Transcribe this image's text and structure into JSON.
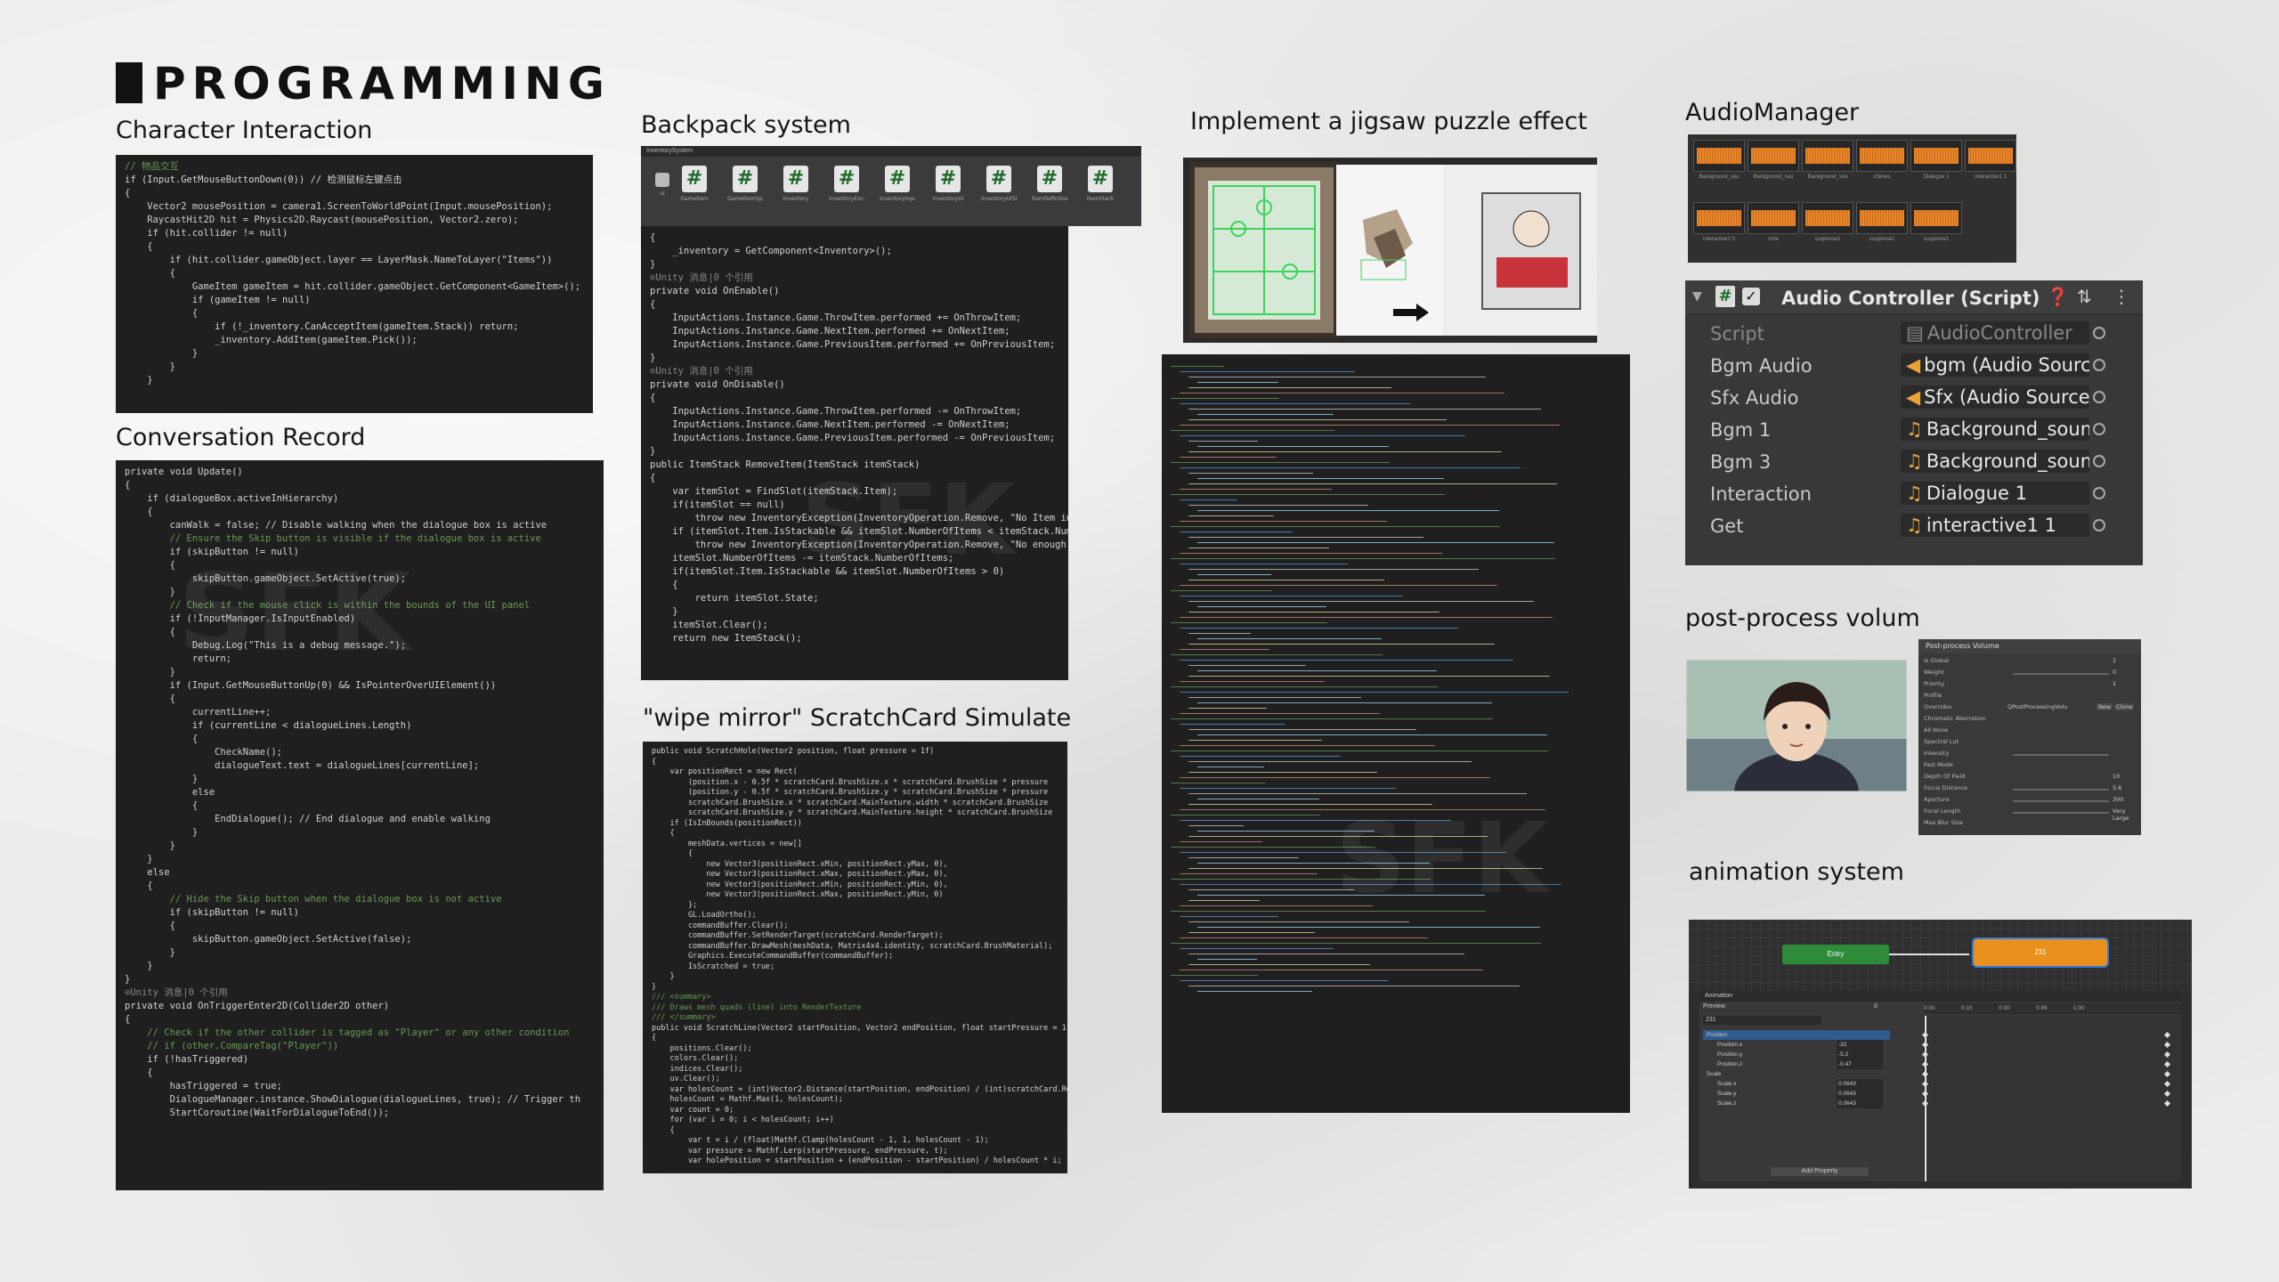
{
  "page": {
    "title": "PROGRAMMING"
  },
  "sections": {
    "character_interaction": "Character Interaction",
    "conversation_record": "Conversation Record",
    "backpack_system": "Backpack system",
    "scratchcard": "\"wipe mirror\" ScratchCard Simulate",
    "jigsaw": "Implement a jigsaw puzzle effect",
    "audio_manager": "AudioManager",
    "post_process": "post-process volum",
    "animation_system": "animation system"
  },
  "code": {
    "character_interaction": [
      "// 物品交互",
      "if (Input.GetMouseButtonDown(0)) // 检测鼠标左键点击",
      "{",
      "    Vector2 mousePosition = camera1.ScreenToWorldPoint(Input.mousePosition);",
      "    RaycastHit2D hit = Physics2D.Raycast(mousePosition, Vector2.zero);",
      "",
      "    if (hit.collider != null)",
      "    {",
      "        if (hit.collider.gameObject.layer == LayerMask.NameToLayer(\"Items\"))",
      "        {",
      "            GameItem gameItem = hit.collider.gameObject.GetComponent<GameItem>();",
      "            if (gameItem != null)",
      "            {",
      "                if (!_inventory.CanAcceptItem(gameItem.Stack)) return;",
      "                _inventory.AddItem(gameItem.Pick());",
      "            }",
      "        }",
      "    }"
    ],
    "conversation_record": [
      "private void Update()",
      "{",
      "    if (dialogueBox.activeInHierarchy)",
      "    {",
      "        canWalk = false; // Disable walking when the dialogue box is active",
      "",
      "        // Ensure the Skip button is visible if the dialogue box is active",
      "        if (skipButton != null)",
      "        {",
      "            skipButton.gameObject.SetActive(true);",
      "        }",
      "",
      "        // Check if the mouse click is within the bounds of the UI panel",
      "        if (!InputManager.IsInputEnabled)",
      "        {",
      "            Debug.Log(\"This is a debug message.\");",
      "            return;",
      "        }",
      "        if (Input.GetMouseButtonUp(0) && IsPointerOverUIElement())",
      "        {",
      "            currentLine++;",
      "",
      "            if (currentLine < dialogueLines.Length)",
      "            {",
      "                CheckName();",
      "                dialogueText.text = dialogueLines[currentLine];",
      "            }",
      "            else",
      "            {",
      "                EndDialogue(); // End dialogue and enable walking",
      "            }",
      "        }",
      "    }",
      "    else",
      "    {",
      "        // Hide the Skip button when the dialogue box is not active",
      "        if (skipButton != null)",
      "        {",
      "            skipButton.gameObject.SetActive(false);",
      "        }",
      "    }",
      "}",
      "",
      "⊙Unity 消息|0 个引用",
      "private void OnTriggerEnter2D(Collider2D other)",
      "{",
      "    // Check if the other collider is tagged as \"Player\" or any other condition",
      "    // if (other.CompareTag(\"Player\"))",
      "    if (!hasTriggered)",
      "    {",
      "        hasTriggered = true;",
      "        DialogueManager.instance.ShowDialogue(dialogueLines, true); // Trigger th",
      "        StartCoroutine(WaitForDialogueToEnd());"
    ],
    "backpack": [
      "{",
      "    _inventory = GetComponent<Inventory>();",
      "}",
      "",
      "⊙Unity 消息|0 个引用",
      "private void OnEnable()",
      "{",
      "    InputActions.Instance.Game.ThrowItem.performed += OnThrowItem;",
      "    InputActions.Instance.Game.NextItem.performed += OnNextItem;",
      "    InputActions.Instance.Game.PreviousItem.performed += OnPreviousItem;",
      "}",
      "",
      "⊙Unity 消息|0 个引用",
      "private void OnDisable()",
      "{",
      "    InputActions.Instance.Game.ThrowItem.performed -= OnThrowItem;",
      "    InputActions.Instance.Game.NextItem.performed -= OnNextItem;",
      "    InputActions.Instance.Game.PreviousItem.performed -= OnPreviousItem;",
      "}",
      "",
      "public ItemStack RemoveItem(ItemStack itemStack)",
      "{",
      "    var itemSlot = FindSlot(itemStack.Item);",
      "    if(itemSlot == null)",
      "        throw new InventoryException(InventoryOperation.Remove, \"No Item in the inventory\");",
      "    if (itemSlot.Item.IsStackable && itemSlot.NumberOfItems < itemStack.NumberOfItems)",
      "        throw new InventoryException(InventoryOperation.Remove, \"No enough Items\");",
      "",
      "    itemSlot.NumberOfItems -= itemStack.NumberOfItems;",
      "    if(itemSlot.Item.IsStackable && itemSlot.NumberOfItems > 0)",
      "    {",
      "        return itemSlot.State;",
      "    }",
      "    itemSlot.Clear();",
      "    return new ItemStack();"
    ],
    "scratchcard": [
      "public void ScratchHole(Vector2 position, float pressure = 1f)",
      "{",
      "    var positionRect = new Rect(",
      "        (position.x - 0.5f * scratchCard.BrushSize.x * scratchCard.BrushSize * pressure",
      "        (position.y - 0.5f * scratchCard.BrushSize.y * scratchCard.BrushSize * pressure",
      "        scratchCard.BrushSize.x * scratchCard.MainTexture.width * scratchCard.BrushSize",
      "        scratchCard.BrushSize.y * scratchCard.MainTexture.height * scratchCard.BrushSize",
      "",
      "    if (IsInBounds(positionRect))",
      "    {",
      "        meshData.vertices = new[]",
      "        {",
      "            new Vector3(positionRect.xMin, positionRect.yMax, 0),",
      "            new Vector3(positionRect.xMax, positionRect.yMax, 0),",
      "            new Vector3(positionRect.xMin, positionRect.yMin, 0),",
      "            new Vector3(positionRect.xMax, positionRect.yMin, 0)",
      "        };",
      "",
      "        GL.LoadOrtho();",
      "        commandBuffer.Clear();",
      "        commandBuffer.SetRenderTarget(scratchCard.RenderTarget);",
      "        commandBuffer.DrawMesh(meshData, Matrix4x4.identity, scratchCard.BrushMaterial);",
      "        Graphics.ExecuteCommandBuffer(commandBuffer);",
      "        IsScratched = true;",
      "    }",
      "}",
      "",
      "/// <summary>",
      "/// Draws mesh quads (line) into RenderTexture",
      "/// </summary>",
      "public void ScratchLine(Vector2 startPosition, Vector2 endPosition, float startPressure = 1f, float endPre",
      "{",
      "    positions.Clear();",
      "    colors.Clear();",
      "    indices.Clear();",
      "    uv.Clear();",
      "    var holesCount = (int)Vector2.Distance(startPosition, endPosition) / (int)scratchCard.RenderTextureQual",
      "    holesCount = Mathf.Max(1, holesCount);",
      "    var count = 0;",
      "    for (var i = 0; i < holesCount; i++)",
      "    {",
      "        var t = i / (float)Mathf.Clamp(holesCount - 1, 1, holesCount - 1);",
      "        var pressure = Mathf.Lerp(startPressure, endPressure, t);",
      "        var holePosition = startPosition + (endPosition - startPosition) / holesCount * i;"
    ]
  },
  "backpack_toolbar": {
    "title": "InventorySystem",
    "items": [
      "ui",
      "GameItem",
      "GameItemSpawner",
      "Inventory",
      "InventoryExceptio",
      "InventoryInputHa",
      "InventoryUI",
      "InventoryUISlo",
      "ItemDefinition",
      "ItemStack"
    ]
  },
  "audio_manager": {
    "clips": [
      "Background_sou",
      "Background_sou",
      "Background_sou",
      "chimes",
      "Dialogue 1",
      "interactive1 1",
      "interactive1 0",
      "note",
      "suspense1",
      "suspense1",
      "suspense1"
    ],
    "component_title": "Audio Controller (Script)",
    "rows": [
      {
        "key": "Script",
        "value": "AudioController",
        "icon": "script-icon"
      },
      {
        "key": "Bgm Audio",
        "value": "bgm (Audio Source",
        "icon": "audio-source-icon"
      },
      {
        "key": "Sfx Audio",
        "value": "Sfx (Audio Source)",
        "icon": "audio-source-icon"
      },
      {
        "key": "Bgm 1",
        "value": "Background_sounc",
        "icon": "music-note-icon"
      },
      {
        "key": "Bgm 3",
        "value": "Background_sounc",
        "icon": "music-note-icon"
      },
      {
        "key": "Interaction",
        "value": "Dialogue 1",
        "icon": "music-note-icon"
      },
      {
        "key": "Get",
        "value": "interactive1 1",
        "icon": "music-note-icon"
      }
    ]
  },
  "post_process_panel": {
    "title": "Post-process Volume",
    "rows": [
      "Is Global",
      "Weight",
      "Priority",
      "Profile",
      "Overrides",
      "Chromatic Aberration",
      "All None",
      "Spectral Lut",
      "Intensity",
      "Fast Mode",
      "Depth Of Field",
      "Focus Distance",
      "Aperture",
      "Focal Length",
      "Max Blur Size"
    ],
    "profile_value": "QPostProcessingVolu",
    "buttons": [
      "New",
      "Clone"
    ],
    "values": [
      "1",
      "0",
      "1",
      "10",
      "5.6",
      "300",
      "Very Large"
    ]
  },
  "animation_panel": {
    "state_entry": "Entry",
    "state_other": "231",
    "tab_title": "Animation",
    "preview_label": "Preview",
    "clip_name": "231",
    "frame_value": "0",
    "time_labels": [
      "0:00",
      "0:15",
      "0:30",
      "0:45",
      "1:00"
    ],
    "properties": [
      {
        "name": "Position",
        "value": ""
      },
      {
        "name": "Position.x",
        "value": "-32"
      },
      {
        "name": "Position.y",
        "value": "-5.2"
      },
      {
        "name": "Position.z",
        "value": "-0.47"
      },
      {
        "name": "Scale",
        "value": ""
      },
      {
        "name": "Scale.x",
        "value": "0.0643"
      },
      {
        "name": "Scale.y",
        "value": "0.0643"
      },
      {
        "name": "Scale.z",
        "value": "0.0643"
      }
    ],
    "add_property": "Add Property"
  },
  "colors": {
    "code_bg": "#1f1f1f",
    "unity_panel": "#383838",
    "wave_orange": "#e8862a",
    "state_green": "#2e8b3a",
    "state_orange": "#e8911e",
    "keyframe_highlight": "#2f5b8f"
  }
}
